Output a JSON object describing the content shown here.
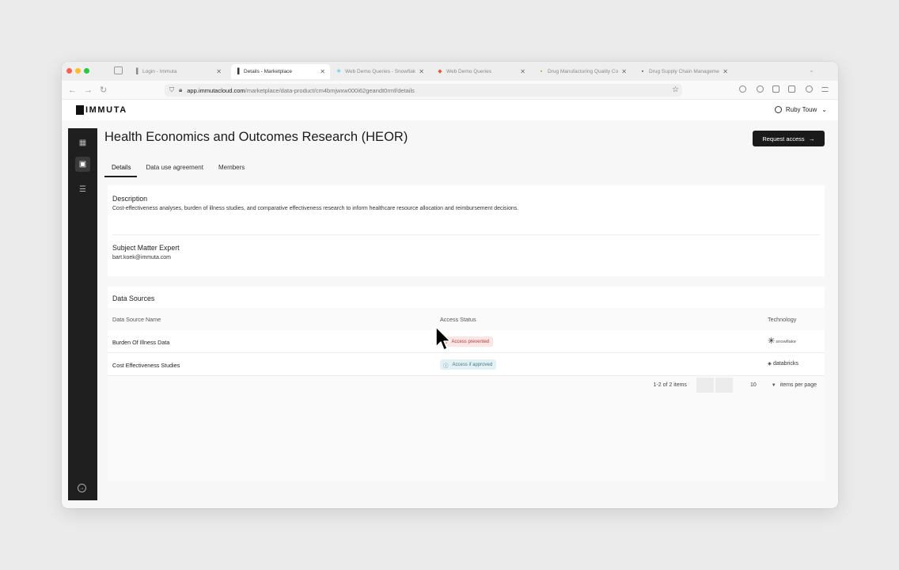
{
  "browser": {
    "tabs": [
      {
        "label": "Login - Immuta",
        "icon": "immuta-icon",
        "close": "✕"
      },
      {
        "label": "Details - Marketplace",
        "icon": "immuta-icon",
        "close": "✕"
      },
      {
        "label": "Web Demo Queries - Snowflake",
        "icon": "snowflake-icon",
        "close": "✕"
      },
      {
        "label": "Web Demo Queries",
        "icon": "databricks-icon",
        "close": "✕"
      },
      {
        "label": "Drug Manufacturing Quality Co",
        "icon": "folder-icon",
        "close": "✕"
      },
      {
        "label": "Drug Supply Chain Managemen",
        "icon": "app-icon",
        "close": "✕"
      }
    ],
    "url_host": "app.immutacloud.com",
    "url_path": "/marketplace/data-product/cm4bmjwxw000i62geandt0rmf/details"
  },
  "app": {
    "logo_text": "IMMUTA",
    "user_name": "Ruby Touw"
  },
  "page": {
    "title": "Health Economics and Outcomes Research (HEOR)",
    "request_button": "Request access",
    "tabs": [
      "Details",
      "Data use agreement",
      "Members"
    ],
    "description_heading": "Description",
    "description_text": "Cost-effectiveness analyses, burden of illness studies, and comparative effectiveness research to inform healthcare resource allocation and reimbursement decisions.",
    "sme_heading": "Subject Matter Expert",
    "sme_email": "bart.koek@immuta.com",
    "sources_heading": "Data Sources",
    "columns": [
      "Data Source Name",
      "Access Status",
      "Technology"
    ],
    "rows": [
      {
        "name": "Burden Of Illness Data",
        "status": "Access prevented",
        "status_type": "prevented",
        "technology": "snowflake"
      },
      {
        "name": "Cost Effectiveness Studies",
        "status": "Access if approved",
        "status_type": "approved",
        "technology": "databricks"
      }
    ],
    "pagination": {
      "count": "1-2 of 2 items",
      "page_size": "10",
      "page_size_label": "items per page"
    }
  },
  "colors": {
    "primary_button": "#1a1a1a",
    "sidebar": "#1f1f1f",
    "prevented_bg": "#fbe6e6",
    "prevented_text": "#b83a3a",
    "approved_bg": "#e4f1f4",
    "approved_text": "#3d7a85"
  }
}
